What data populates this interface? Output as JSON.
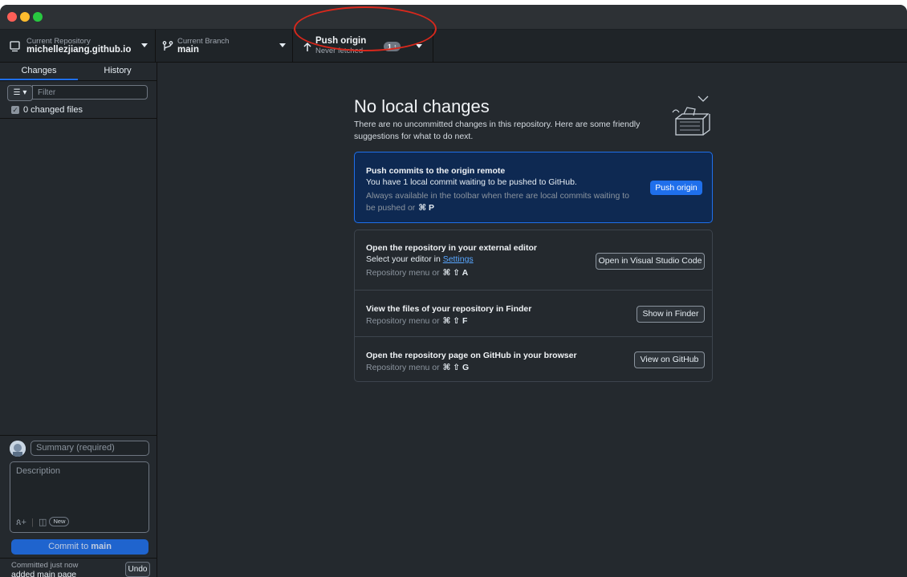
{
  "toolbar": {
    "repo": {
      "caption": "Current Repository",
      "name": "michellezjiang.github.io"
    },
    "branch": {
      "caption": "Current Branch",
      "name": "main"
    },
    "push": {
      "title": "Push origin",
      "subtitle": "Never fetched",
      "count": "1 ↑"
    }
  },
  "sidebar": {
    "tabs": [
      "Changes",
      "History"
    ],
    "filter_placeholder": "Filter",
    "changed_files": "0 changed files",
    "summary_placeholder": "Summary (required)",
    "description_placeholder": "Description",
    "new_badge": "New",
    "commit_prefix": "Commit to ",
    "commit_branch": "main",
    "last_commit": {
      "time": "Committed just now",
      "message": "added main page"
    },
    "undo_label": "Undo"
  },
  "main": {
    "title": "No local changes",
    "subtitle": "There are no uncommitted changes in this repository. Here are some friendly suggestions for what to do next.",
    "push_card": {
      "title": "Push commits to the origin remote",
      "line": "You have 1 local commit waiting to be pushed to GitHub.",
      "hint": "Always available in the toolbar when there are local commits waiting to be pushed or",
      "shortcut": "⌘ P",
      "button": "Push origin"
    },
    "actions": [
      {
        "title": "Open the repository in your external editor",
        "line_prefix": "Select your editor in ",
        "line_link": "Settings",
        "hint": "Repository menu or",
        "shortcut": "⌘ ⇧ A",
        "button": "Open in Visual Studio Code"
      },
      {
        "title": "View the files of your repository in Finder",
        "hint": "Repository menu or",
        "shortcut": "⌘ ⇧ F",
        "button": "Show in Finder"
      },
      {
        "title": "Open the repository page on GitHub in your browser",
        "hint": "Repository menu or",
        "shortcut": "⌘ ⇧ G",
        "button": "View on GitHub"
      }
    ]
  },
  "colors": {
    "accent": "#1f6feb",
    "annotation": "#d9281c",
    "background": "#24292e"
  }
}
